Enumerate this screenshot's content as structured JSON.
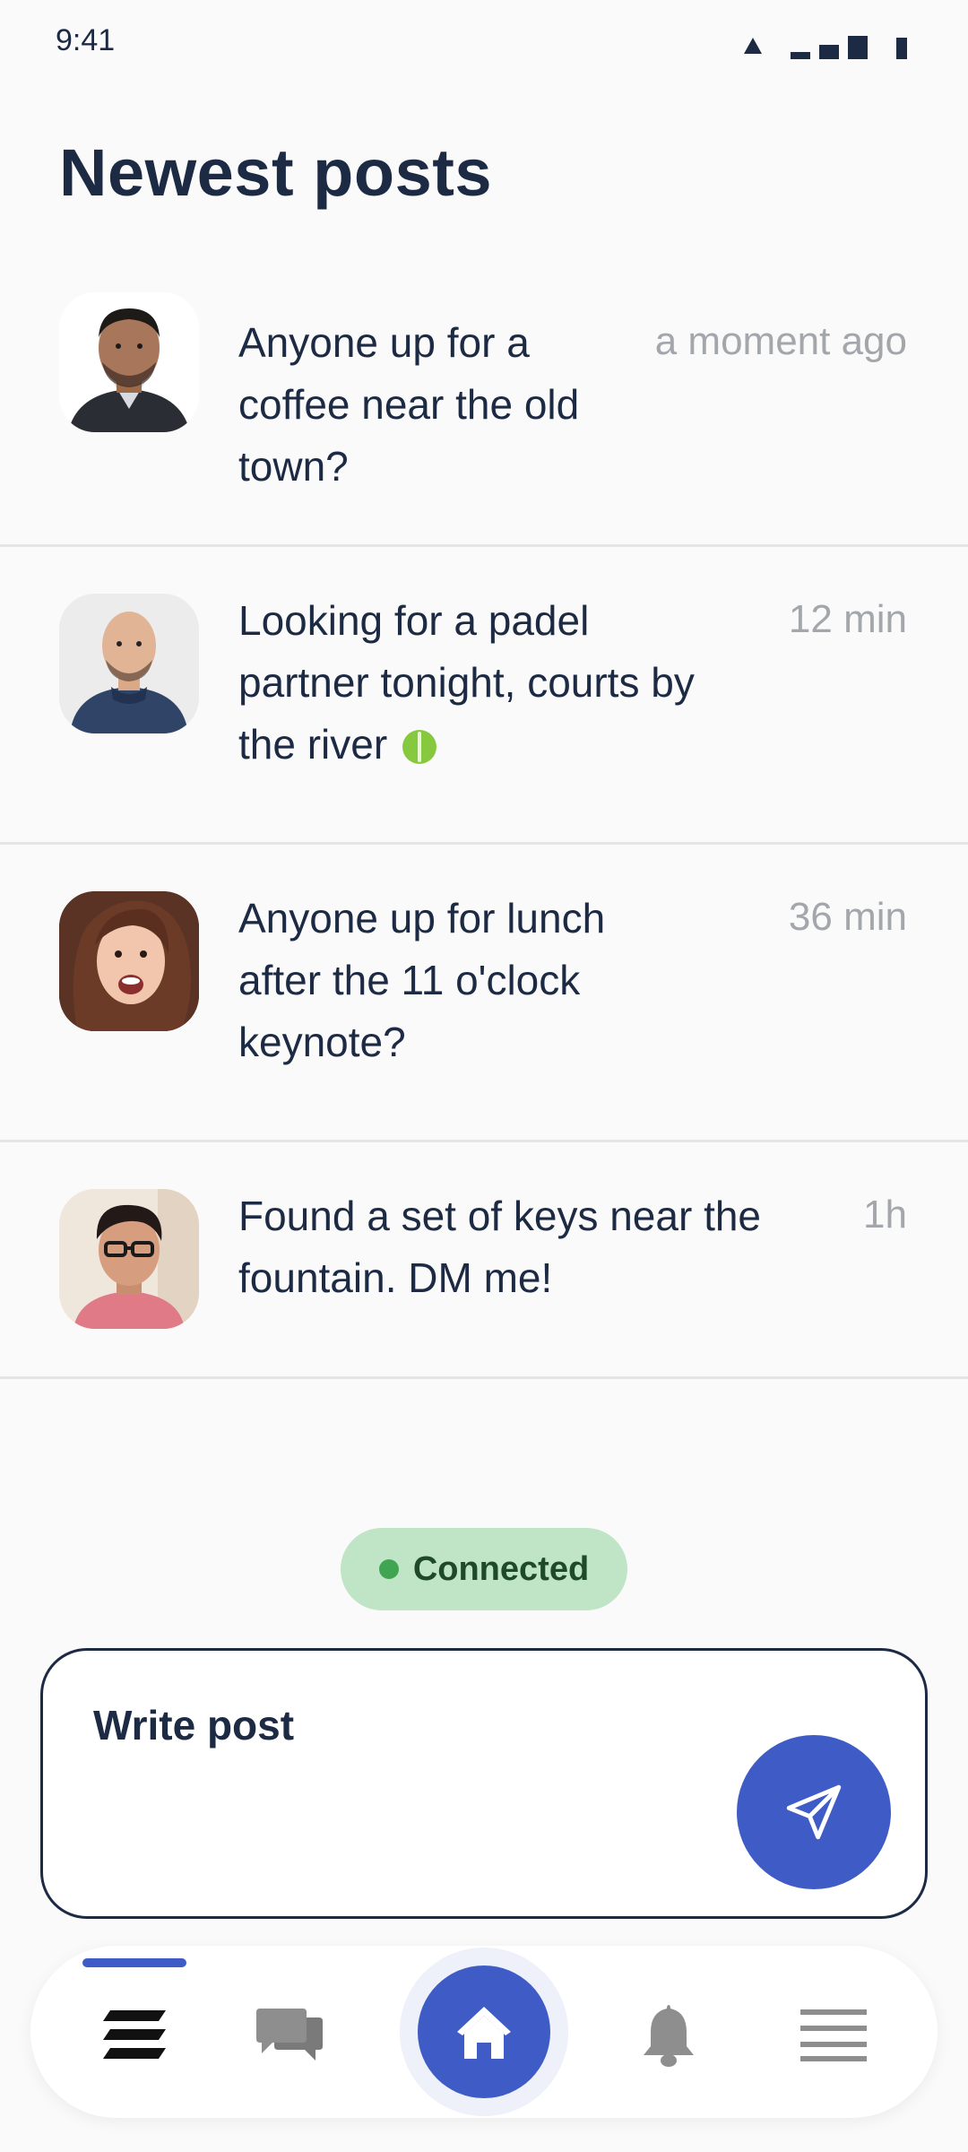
{
  "status_bar": {
    "time": "9:41"
  },
  "page": {
    "title": "Newest posts"
  },
  "posts": [
    {
      "text": "Anyone up for a coffee near the old town?",
      "time": "a moment ago"
    },
    {
      "text": "Looking for a padel partner tonight, courts by the river",
      "time": "12 min",
      "emoji": "tennis-ball-icon"
    },
    {
      "text": "Anyone up for lunch after the 11 o'clock keynote?",
      "time": "36 min"
    },
    {
      "text": "Found a set of keys near the fountain. DM me!",
      "time": "1h"
    }
  ],
  "connection": {
    "label": "Connected",
    "color": "#3fa552"
  },
  "compose": {
    "label": "Write post"
  },
  "nav": {
    "items": [
      "feed-icon",
      "chat-icon",
      "home-icon",
      "bell-icon",
      "menu-icon"
    ],
    "active": "feed-icon"
  },
  "colors": {
    "accent": "#3f5cc6",
    "text": "#1c2a43",
    "muted": "#a3a6ab",
    "connected_bg": "#bfe4c6"
  }
}
